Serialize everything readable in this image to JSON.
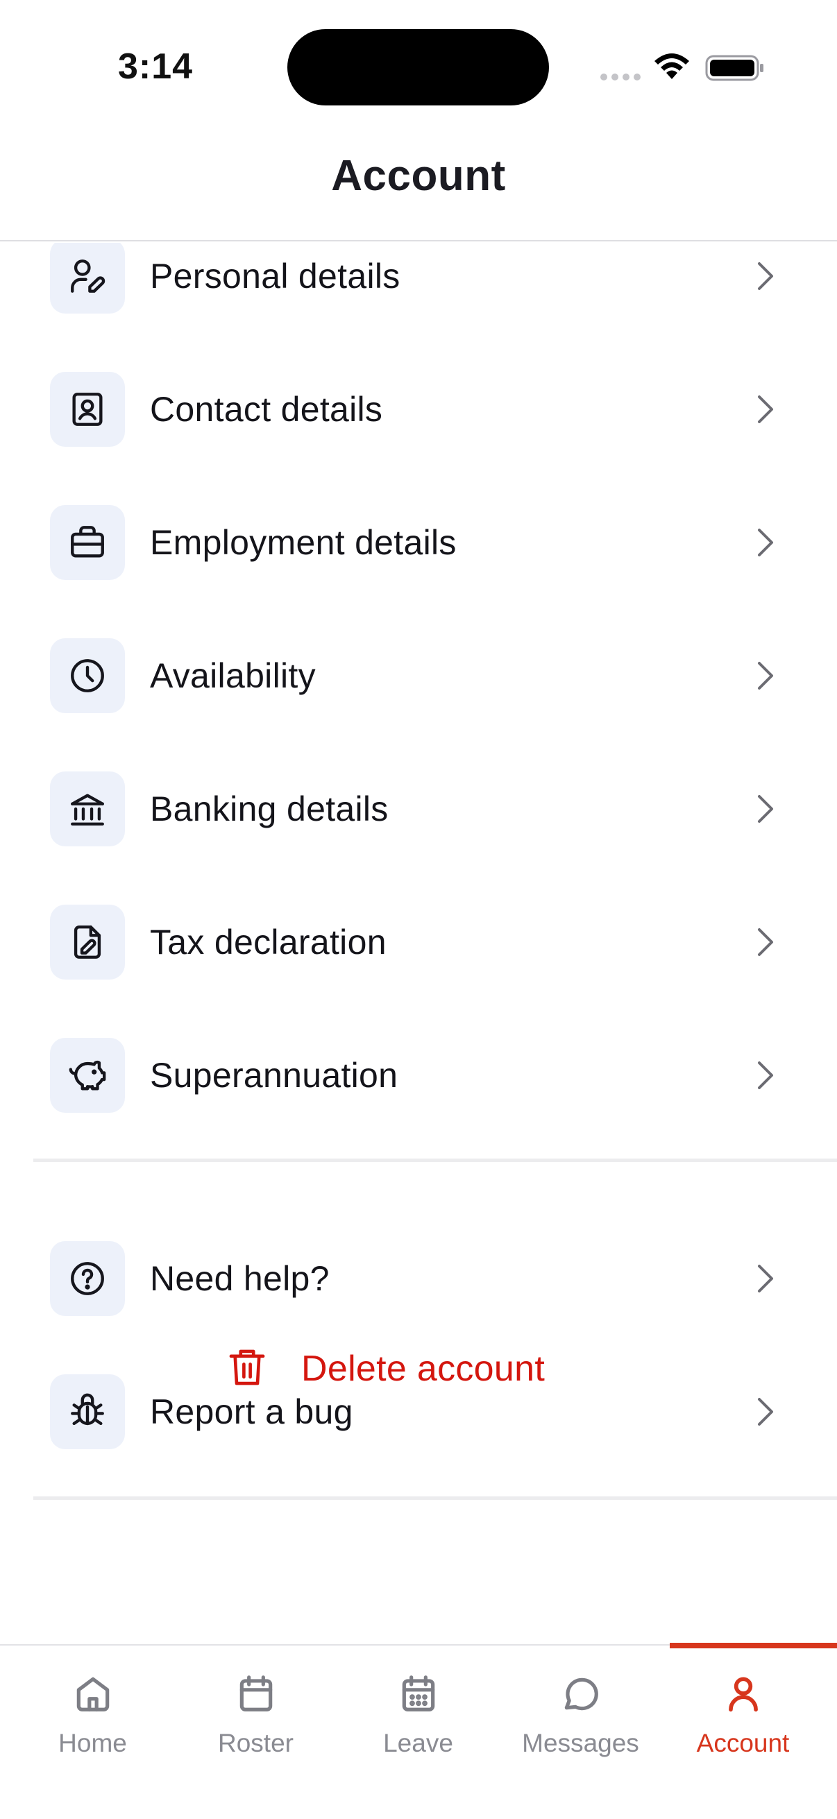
{
  "status_bar": {
    "time": "3:14"
  },
  "header": {
    "title": "Account"
  },
  "menu": {
    "items": [
      {
        "label": "Personal details",
        "icon": "user-edit-icon"
      },
      {
        "label": "Contact details",
        "icon": "contact-card-icon"
      },
      {
        "label": "Employment details",
        "icon": "briefcase-icon"
      },
      {
        "label": "Availability",
        "icon": "clock-icon"
      },
      {
        "label": "Banking details",
        "icon": "bank-icon"
      },
      {
        "label": "Tax declaration",
        "icon": "document-edit-icon"
      },
      {
        "label": "Superannuation",
        "icon": "piggy-bank-icon"
      }
    ],
    "support": [
      {
        "label": "Need help?",
        "icon": "help-circle-icon"
      },
      {
        "label": "Report a bug",
        "icon": "bug-icon"
      }
    ]
  },
  "delete": {
    "label": "Delete account",
    "color": "#d4160e"
  },
  "tab_bar": {
    "tabs": [
      {
        "label": "Home",
        "icon": "home-icon"
      },
      {
        "label": "Roster",
        "icon": "calendar-icon"
      },
      {
        "label": "Leave",
        "icon": "calendar-grid-icon"
      },
      {
        "label": "Messages",
        "icon": "chat-bubble-icon"
      },
      {
        "label": "Account",
        "icon": "person-icon"
      }
    ],
    "active": "Account",
    "accent": "#d7361d"
  },
  "colors": {
    "icon_bg": "#edf1fa",
    "inactive": "#8a8b92"
  }
}
